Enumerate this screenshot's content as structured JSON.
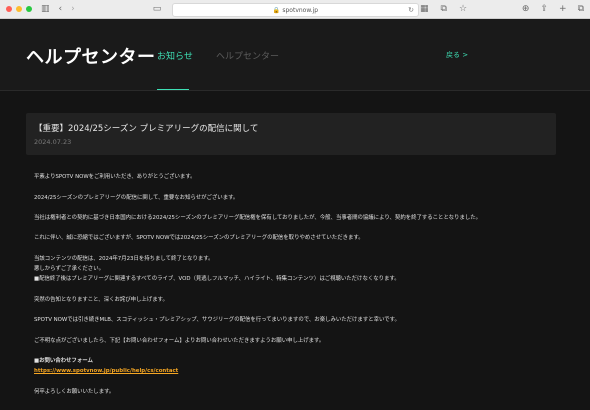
{
  "browser": {
    "url": "spotvnow.jp"
  },
  "header": {
    "brand": "ヘルプセンター",
    "nav_news": "お知らせ",
    "nav_help": "ヘルプセンター",
    "back": "戻る >"
  },
  "article": {
    "title": "【重要】2024/25シーズン プレミアリーグの配信に関して",
    "date": "2024.07.23"
  },
  "body": {
    "p1": "平素よりSPOTV NOWをご利用いただき、ありがとうございます。",
    "p2": "2024/25シーズンのプレミアリーグの配信に関して、重要なお知らせがございます。",
    "p3": "当社は権利者との契約に基づき日本国内における2024/25シーズンのプレミアリーグ配信権を保有しておりましたが、今般、当事者間の協議により、契約を終了することとなりました。",
    "p4": "これに伴い、誠に恐縮ではございますが、SPOTV NOWでは2024/25シーズンのプレミアリーグの配信を取りやめさせていただきます。",
    "p5a": "当該コンテンツの配信は、2024年7月23日を持ちまして終了となります。",
    "p5b": "悪しからずご了承ください。",
    "p5c": "■配信終了後はプレミアリーグに関連するすべてのライブ、VOD（見逃しフルマッチ、ハイライト、特集コンテンツ）はご視聴いただけなくなります。",
    "p6": "突然の告知となりますこと、深くお詫び申し上げます。",
    "p7": "SPOTV NOWでは引き続きMLB、スコティッシュ・プレミアシップ、サウジリーグの配信を行ってまいりますので、お楽しみいただけますと幸いです。",
    "p8": "ご不明な点がございましたら、下記【お問い合わせフォーム】よりお問い合わせいただきますようお願い申し上げます。",
    "p9a": "■お問い合わせフォーム",
    "p9b": "https://www.spotvnow.jp/public/help/cs/contact",
    "p10": "何卒よろしくお願いいたします。"
  },
  "colors": {
    "accent": "#3ee0b5",
    "link": "#f5a623",
    "background": "#141414"
  }
}
